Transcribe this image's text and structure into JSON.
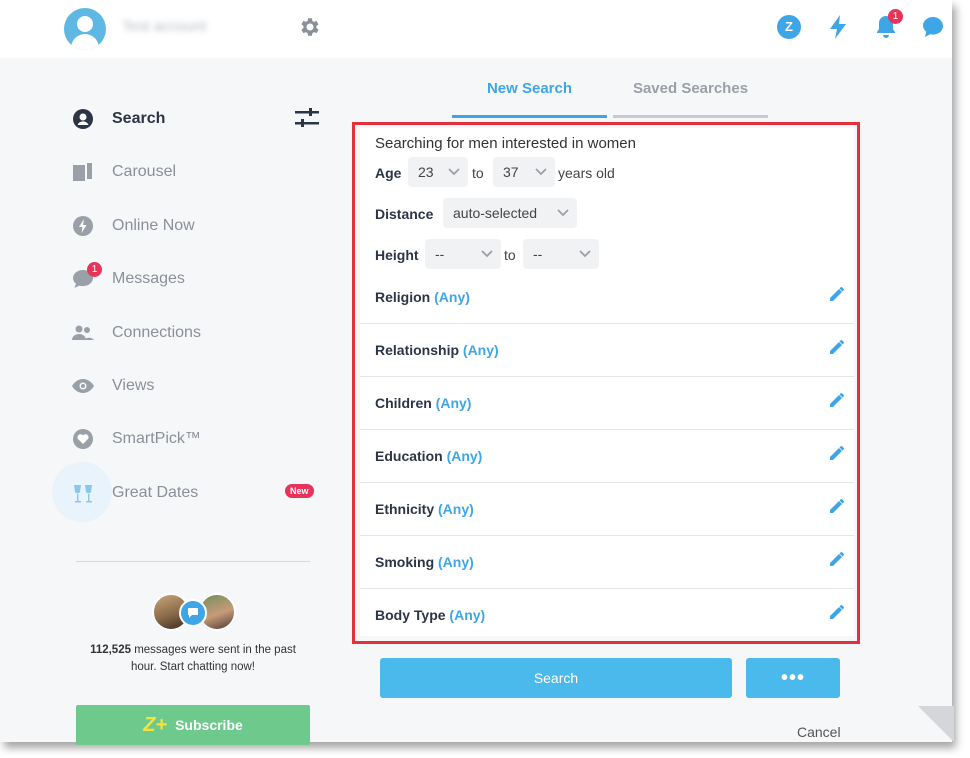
{
  "header": {
    "account_name": "Test account",
    "notification_count": "1",
    "z_label": "Z"
  },
  "sidebar": {
    "items": [
      {
        "label": "Search",
        "icon": "user-circle-icon"
      },
      {
        "label": "Carousel",
        "icon": "cards-icon"
      },
      {
        "label": "Online Now",
        "icon": "bolt-icon"
      },
      {
        "label": "Messages",
        "icon": "chat-bubble-icon",
        "badge": "1"
      },
      {
        "label": "Connections",
        "icon": "people-icon"
      },
      {
        "label": "Views",
        "icon": "eye-icon"
      },
      {
        "label": "SmartPick™",
        "icon": "heart-badge-icon"
      },
      {
        "label": "Great Dates",
        "icon": "glasses-cheers-icon",
        "badge": "New"
      }
    ],
    "stats_count": "112,525",
    "stats_text": " messages were sent in the past hour. Start chatting now!",
    "subscribe_logo": "Z+",
    "subscribe_label": "Subscribe"
  },
  "tabs": {
    "new_search": "New Search",
    "saved_searches": "Saved Searches"
  },
  "search": {
    "title": "Searching for men interested in women",
    "age_label": "Age",
    "age_min": "23",
    "age_to": "to",
    "age_max": "37",
    "age_suffix": "years old",
    "distance_label": "Distance",
    "distance_value": "auto-selected",
    "height_label": "Height",
    "height_min": "--",
    "height_to": "to",
    "height_max": "--",
    "any": "(Any)",
    "rows": [
      "Religion",
      "Relationship",
      "Children",
      "Education",
      "Ethnicity",
      "Smoking",
      "Body Type"
    ]
  },
  "buttons": {
    "search": "Search",
    "more": "•••",
    "cancel": "Cancel"
  },
  "colors": {
    "accent": "#3ea6e6",
    "badge": "#e8345a",
    "subscribe": "#6ec98c",
    "highlight_box": "#e2313a"
  }
}
